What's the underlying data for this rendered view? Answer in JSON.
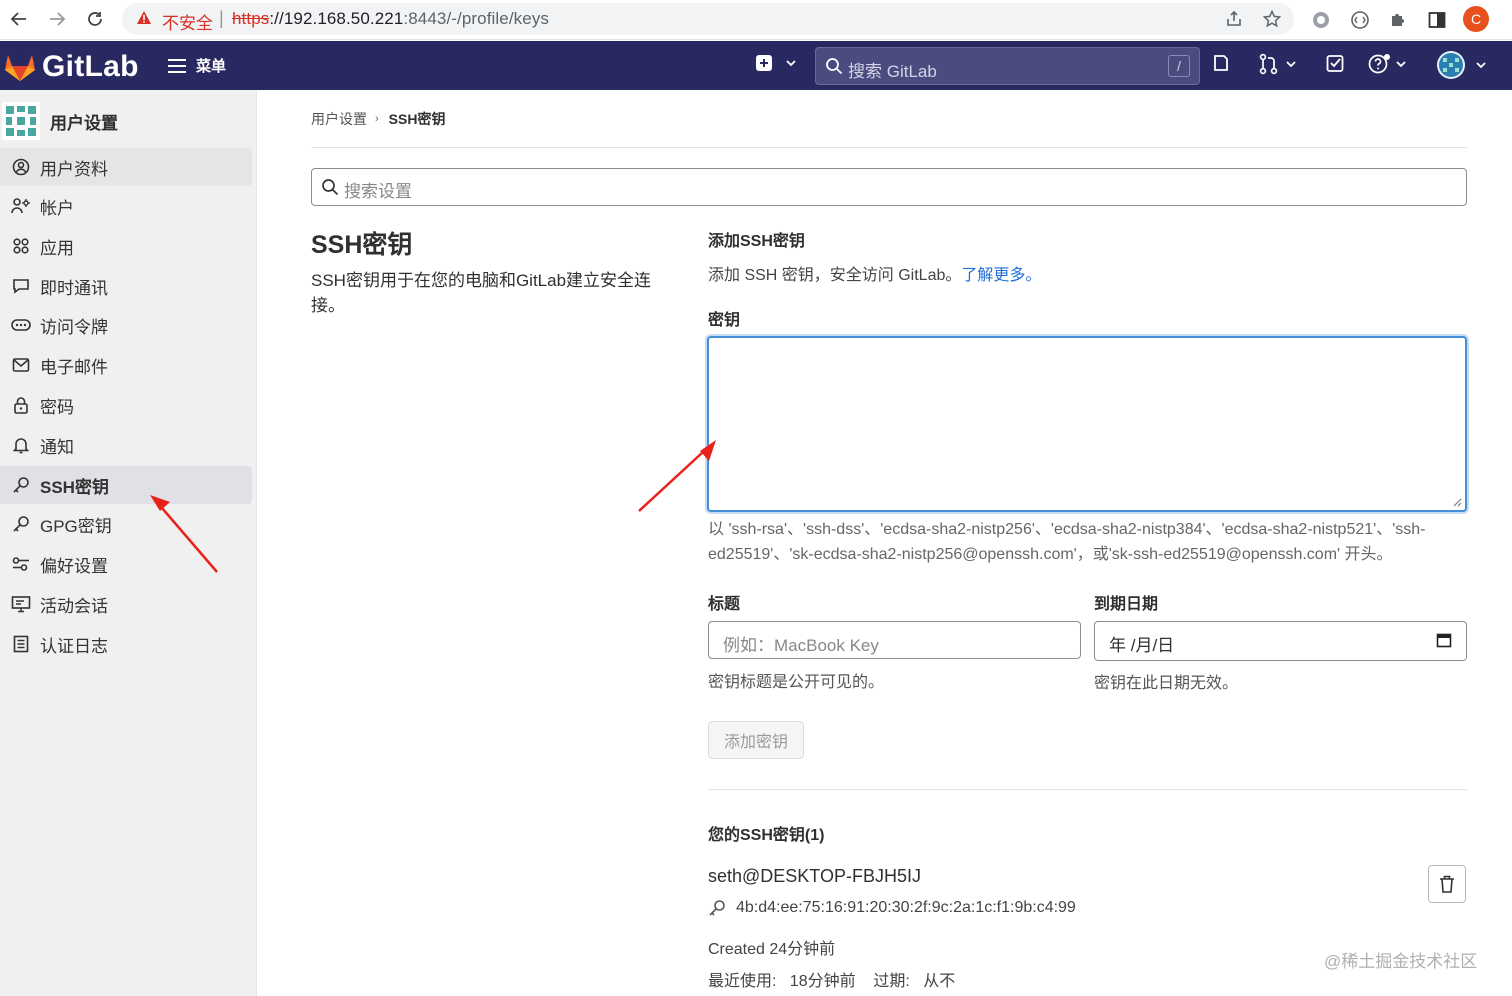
{
  "browser": {
    "insecure_label": "不安全",
    "url_proto": "https",
    "url_host": "://192.168.50.221",
    "url_rest": ":8443/-/profile/keys",
    "profile_initial": "C"
  },
  "header": {
    "logo_text": "GitLab",
    "menu_label": "菜单",
    "search_placeholder": "搜索 GitLab",
    "search_shortcut": "/"
  },
  "sidebar": {
    "title": "用户设置",
    "items": [
      {
        "label": "用户资料",
        "icon": "profile-icon"
      },
      {
        "label": "帐户",
        "icon": "account-icon"
      },
      {
        "label": "应用",
        "icon": "applications-icon"
      },
      {
        "label": "即时通讯",
        "icon": "chat-icon"
      },
      {
        "label": "访问令牌",
        "icon": "token-icon"
      },
      {
        "label": "电子邮件",
        "icon": "mail-icon"
      },
      {
        "label": "密码",
        "icon": "lock-icon"
      },
      {
        "label": "通知",
        "icon": "bell-icon"
      },
      {
        "label": "SSH密钥",
        "icon": "key-icon",
        "active": true
      },
      {
        "label": "GPG密钥",
        "icon": "key-icon"
      },
      {
        "label": "偏好设置",
        "icon": "preferences-icon"
      },
      {
        "label": "活动会话",
        "icon": "monitor-icon"
      },
      {
        "label": "认证日志",
        "icon": "log-icon"
      }
    ]
  },
  "breadcrumb": {
    "parent": "用户设置",
    "current": "SSH密钥"
  },
  "settings_search_placeholder": "搜索设置",
  "section": {
    "title": "SSH密钥",
    "description": "SSH密钥用于在您的电脑和GitLab建立安全连接。"
  },
  "form": {
    "heading": "添加SSH密钥",
    "intro": "添加 SSH 密钥，安全访问 GitLab。",
    "learn_more": "了解更多。",
    "key_label": "密钥",
    "key_help": "以 'ssh-rsa'、'ssh-dss'、'ecdsa-sha2-nistp256'、'ecdsa-sha2-nistp384'、'ecdsa-sha2-nistp521'、'ssh-ed25519'、'sk-ecdsa-sha2-nistp256@openssh.com'，或'sk-ssh-ed25519@openssh.com' 开头。",
    "title_label": "标题",
    "title_placeholder": "例如：MacBook Key",
    "title_help": "密钥标题是公开可见的。",
    "expiry_label": "到期日期",
    "expiry_value": "年 /月/日",
    "expiry_help": "密钥在此日期无效。",
    "submit": "添加密钥"
  },
  "keys": {
    "heading": "您的SSH密钥(1)",
    "items": [
      {
        "name": "seth@DESKTOP-FBJH5IJ",
        "fingerprint": "4b:d4:ee:75:16:91:20:30:2f:9c:2a:1c:f1:9b:c4:99",
        "created": "Created 24分钟前",
        "last_used_label": "最近使用:",
        "last_used": "18分钟前",
        "expires_label": "过期:",
        "expires": "从不"
      }
    ]
  },
  "watermark": "@稀土掘金技术社区",
  "colors": {
    "header_bg": "#292961",
    "link": "#1f6fd6",
    "focus": "#428fdc",
    "annotation": "#e8221b"
  }
}
